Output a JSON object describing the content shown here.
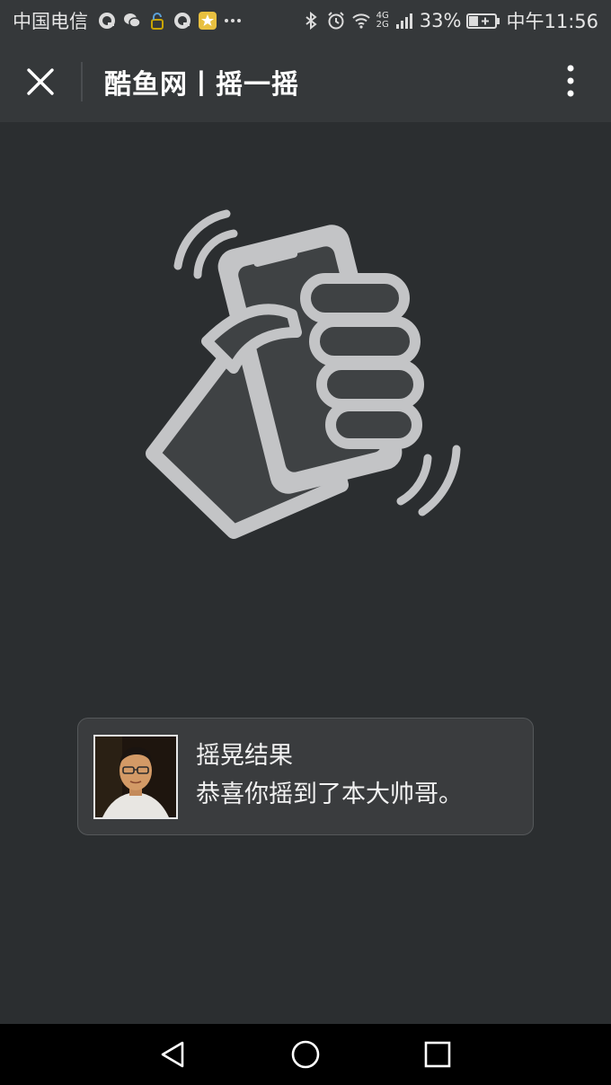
{
  "status_bar": {
    "carrier": "中国电信",
    "network_label": "4G",
    "network_label_2": "2G",
    "battery": "33%",
    "time": "中午11:56",
    "left_icons": [
      "qq-icon",
      "wechat-icon",
      "lock-icon",
      "qq-icon",
      "star-app-icon",
      "more-dots-icon"
    ],
    "right_icons": [
      "bluetooth-icon",
      "alarm-icon",
      "wifi-icon",
      "signal-icon",
      "battery-icon"
    ]
  },
  "title_bar": {
    "title": "酷鱼网丨摇一摇",
    "close_icon": "close-icon",
    "more_icon": "more-vertical-icon"
  },
  "hero": {
    "icon": "shake-phone-icon"
  },
  "result": {
    "title": "摇晃结果",
    "description": "恭喜你摇到了本大帅哥。"
  },
  "nav_bar": {
    "back_icon": "back-triangle-icon",
    "home_icon": "home-circle-icon",
    "recents_icon": "recents-square-icon"
  },
  "colors": {
    "background": "#2b2e30",
    "bar": "#35383a",
    "card": "#3a3c3e",
    "icon_gray": "#c3c4c6"
  }
}
